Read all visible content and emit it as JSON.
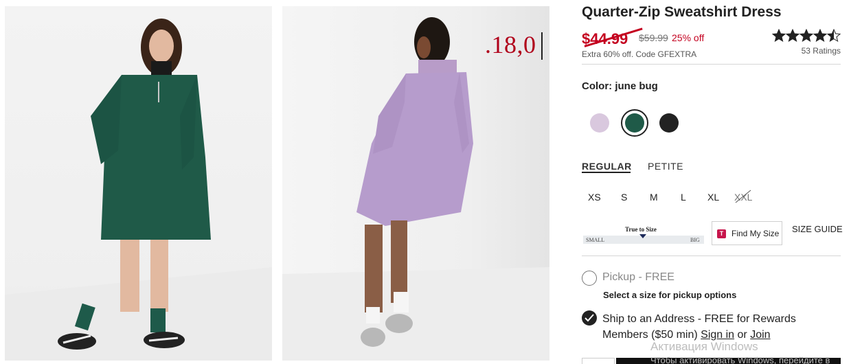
{
  "overlay": {
    "price_fragment": ".18,0"
  },
  "product": {
    "title": "Quarter-Zip Sweatshirt Dress",
    "price_current": "$44.99",
    "price_original": "$59.99",
    "discount": "25% off",
    "promo": "Extra 60% off. Code GFEXTRA",
    "rating_stars": "★★★★★",
    "rating_value": 4.5,
    "ratings_count": "53 Ratings"
  },
  "color": {
    "label": "Color:",
    "selected": "june bug",
    "swatches": [
      {
        "name": "lilac",
        "hex": "#d9c8de"
      },
      {
        "name": "june bug",
        "hex": "#1f5a48"
      },
      {
        "name": "black",
        "hex": "#222222"
      }
    ]
  },
  "fit": {
    "tabs": [
      "REGULAR",
      "PETITE"
    ],
    "selected_tab": "REGULAR",
    "sizes": [
      "XS",
      "S",
      "M",
      "L",
      "XL",
      "XXL"
    ],
    "unavailable": [
      "XXL"
    ],
    "true_to_size_label": "True to Size",
    "scale_small": "SMALL",
    "scale_big": "BIG",
    "find_my_size": "Find My Size",
    "find_my_size_icon": "T",
    "size_guide": "SIZE GUIDE"
  },
  "fulfillment": {
    "pickup_label": "Pickup - FREE",
    "pickup_note": "Select a size for pickup options",
    "ship_label": "Ship to an Address - FREE for Rewards Members ($50 min)",
    "sign_in": "Sign in",
    "or": "or",
    "join": "Join"
  },
  "system": {
    "activate_title": "Активация Windows",
    "activate_text": "Чтобы активировать Windows, перейдите в"
  },
  "colors": {
    "sale_red": "#c4001f",
    "text": "#222222"
  }
}
